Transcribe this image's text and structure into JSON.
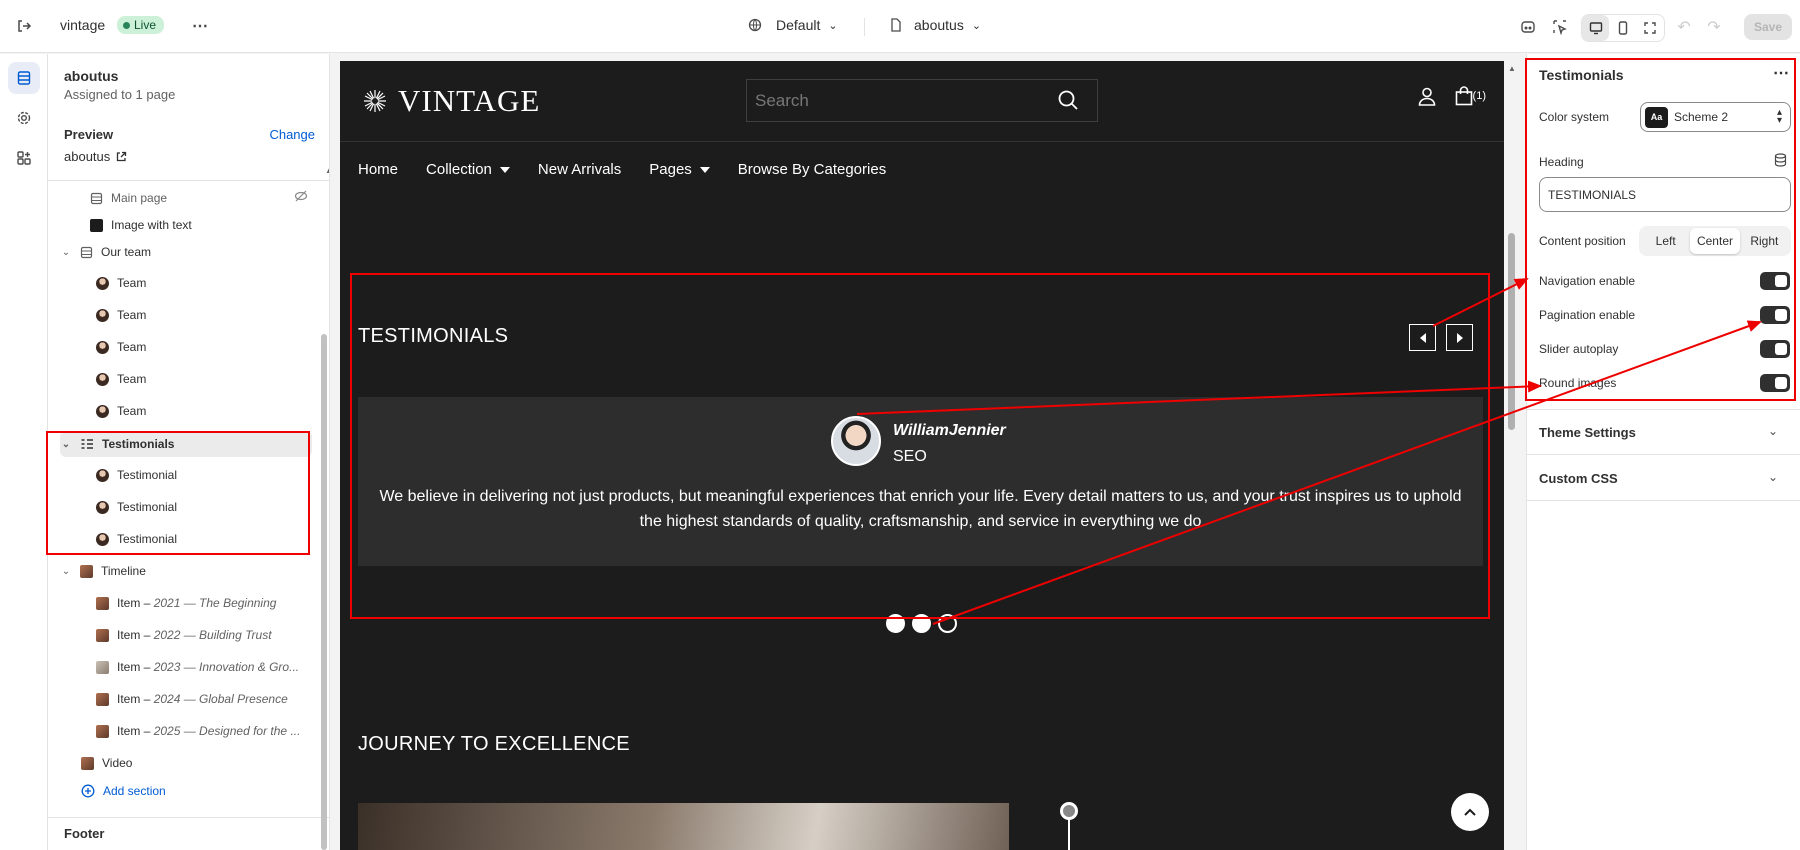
{
  "topbar": {
    "store_name": "vintage",
    "live_label": "Live",
    "theme_label": "Default",
    "page_label": "aboutus",
    "save_label": "Save"
  },
  "sidebar": {
    "title": "aboutus",
    "subtitle": "Assigned to 1 page",
    "preview_label": "Preview",
    "change_label": "Change",
    "preview_value": "aboutus",
    "tree": {
      "main_page": "Main page",
      "image_with_text": "Image with text",
      "our_team": "Our team",
      "team": [
        "Team",
        "Team",
        "Team",
        "Team",
        "Team"
      ],
      "testimonials": "Testimonials",
      "testimonial": [
        "Testimonial",
        "Testimonial",
        "Testimonial"
      ],
      "timeline": "Timeline",
      "timeline_items": [
        {
          "prefix": "Item – ",
          "title": "2021 — The Beginning"
        },
        {
          "prefix": "Item – ",
          "title": "2022 — Building Trust"
        },
        {
          "prefix": "Item – ",
          "title": "2023 — Innovation & Gro..."
        },
        {
          "prefix": "Item – ",
          "title": "2024 — Global Presence"
        },
        {
          "prefix": "Item – ",
          "title": "2025 — Designed for the ..."
        }
      ],
      "video": "Video",
      "add_section": "Add section"
    },
    "footer_label": "Footer"
  },
  "storefront": {
    "logo_text": "VINTAGE",
    "search_placeholder": "Search",
    "cart_count": "(1)",
    "nav": [
      "Home",
      "Collection",
      "New Arrivals",
      "Pages",
      "Browse By Categories"
    ],
    "testimonials_heading": "TESTIMONIALS",
    "testimonial": {
      "name": "WilliamJennier",
      "role": "SEO",
      "quote": "We believe in delivering not just products, but meaningful experiences that enrich your life. Every detail matters to us, and your trust inspires us to uphold the highest standards of quality, craftsmanship, and service in everything we do"
    },
    "journey_heading": "JOURNEY TO EXCELLENCE"
  },
  "settings": {
    "title": "Testimonials",
    "color_system_label": "Color system",
    "color_system_value": "Scheme 2",
    "swatch_text": "Aa",
    "heading_label": "Heading",
    "heading_value": "TESTIMONIALS",
    "content_position_label": "Content position",
    "content_position_options": [
      "Left",
      "Center",
      "Right"
    ],
    "content_position_selected": "Center",
    "toggles": [
      {
        "label": "Navigation enable",
        "on": true
      },
      {
        "label": "Pagination enable",
        "on": true
      },
      {
        "label": "Slider autoplay",
        "on": true
      },
      {
        "label": "Round images",
        "on": true
      }
    ],
    "theme_settings_label": "Theme Settings",
    "custom_css_label": "Custom CSS"
  },
  "colors": {
    "accent": "#005bd3",
    "storefront_bg": "#1c1c1c",
    "annotation": "#e00000",
    "live": "#29845a"
  }
}
